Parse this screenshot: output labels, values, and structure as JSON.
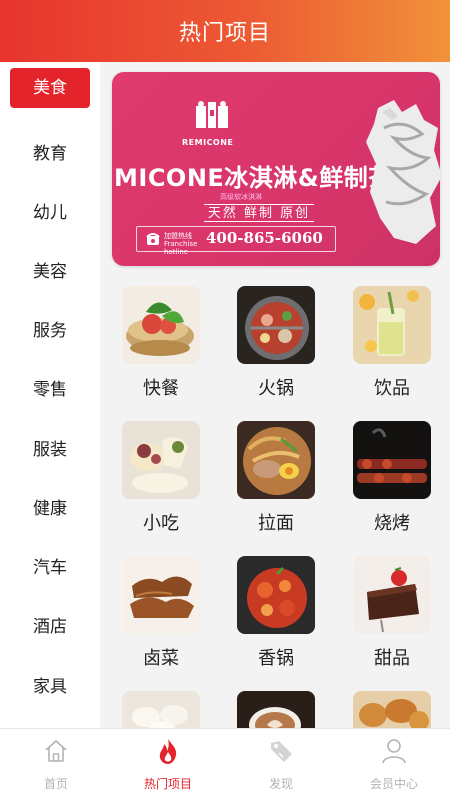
{
  "header": {
    "title": "热门项目"
  },
  "sidebar": {
    "items": [
      {
        "label": "美食",
        "active": true
      },
      {
        "label": "教育"
      },
      {
        "label": "幼儿"
      },
      {
        "label": "美容"
      },
      {
        "label": "服务"
      },
      {
        "label": "零售"
      },
      {
        "label": "服装"
      },
      {
        "label": "健康"
      },
      {
        "label": "汽车"
      },
      {
        "label": "酒店"
      },
      {
        "label": "家具"
      }
    ]
  },
  "banner": {
    "logo_text": "REMICONE",
    "main_text": "MICONE冰淇淋&鲜制茶",
    "sub_text": "高级软冰淇淋",
    "tagline": "天然 鲜制 原创",
    "hotline_label": "加盟热线 Franchise hotline",
    "phone": "400-865-6060",
    "accent_color": "#d8356a"
  },
  "grid": {
    "items": [
      {
        "label": "快餐",
        "icon": "sandwich-photo"
      },
      {
        "label": "火锅",
        "icon": "hotpot-photo"
      },
      {
        "label": "饮品",
        "icon": "drink-photo"
      },
      {
        "label": "小吃",
        "icon": "snack-photo"
      },
      {
        "label": "拉面",
        "icon": "ramen-photo"
      },
      {
        "label": "烧烤",
        "icon": "bbq-photo"
      },
      {
        "label": "卤菜",
        "icon": "braised-photo"
      },
      {
        "label": "香锅",
        "icon": "spicy-pot-photo"
      },
      {
        "label": "甜品",
        "icon": "cake-photo"
      },
      {
        "label": "",
        "icon": "dumpling-photo"
      },
      {
        "label": "",
        "icon": "coffee-photo"
      },
      {
        "label": "",
        "icon": "pastry-photo"
      }
    ]
  },
  "tabbar": {
    "items": [
      {
        "label": "首页",
        "icon": "home-icon"
      },
      {
        "label": "热门项目",
        "icon": "flame-icon",
        "active": true
      },
      {
        "label": "发现",
        "icon": "tag-icon"
      },
      {
        "label": "会员中心",
        "icon": "user-icon"
      }
    ]
  },
  "colors": {
    "primary": "#e4242b",
    "header_start": "#e8342e",
    "header_end": "#f1923a",
    "inactive": "#b3b3b3"
  }
}
